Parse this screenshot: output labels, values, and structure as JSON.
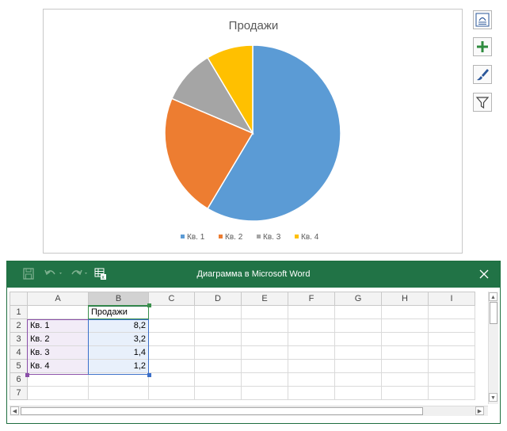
{
  "chart": {
    "title": "Продажи",
    "colors": [
      "#5b9bd5",
      "#ed7d31",
      "#a5a5a5",
      "#ffc000"
    ]
  },
  "chart_data": {
    "type": "pie",
    "title": "Продажи",
    "categories": [
      "Кв. 1",
      "Кв. 2",
      "Кв. 3",
      "Кв. 4"
    ],
    "values": [
      8.2,
      3.2,
      1.4,
      1.2
    ],
    "legend_position": "bottom"
  },
  "chart_tools": [
    {
      "name": "chart-layout-icon"
    },
    {
      "name": "chart-elements-plus-icon"
    },
    {
      "name": "chart-styles-brush-icon"
    },
    {
      "name": "chart-filter-icon"
    }
  ],
  "excel": {
    "window_title": "Диаграмма в Microsoft Word",
    "columns": [
      "A",
      "B",
      "C",
      "D",
      "E",
      "F",
      "G",
      "H",
      "I"
    ],
    "rows": [
      {
        "num": "1",
        "a": "",
        "b": "Продажи"
      },
      {
        "num": "2",
        "a": "Кв. 1",
        "b": "8,2"
      },
      {
        "num": "3",
        "a": "Кв. 2",
        "b": "3,2"
      },
      {
        "num": "4",
        "a": "Кв. 3",
        "b": "1,4"
      },
      {
        "num": "5",
        "a": "Кв. 4",
        "b": "1,2"
      },
      {
        "num": "6",
        "a": "",
        "b": ""
      },
      {
        "num": "7",
        "a": "",
        "b": ""
      }
    ],
    "toolbar_icons": [
      "save-icon",
      "undo-icon",
      "redo-icon",
      "edit-data-in-excel-icon"
    ],
    "close_icon": "close-icon"
  }
}
